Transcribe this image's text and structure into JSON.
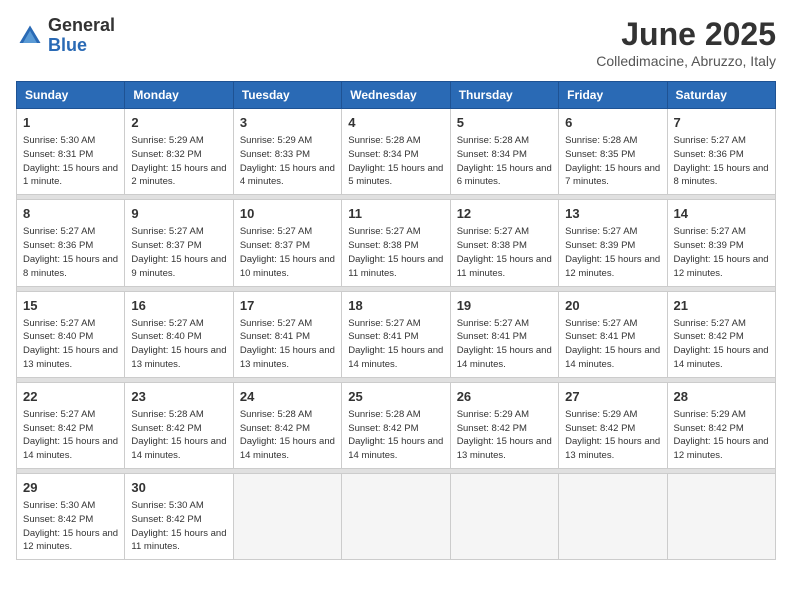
{
  "logo": {
    "general": "General",
    "blue": "Blue"
  },
  "header": {
    "month": "June 2025",
    "location": "Colledimacine, Abruzzo, Italy"
  },
  "columns": [
    "Sunday",
    "Monday",
    "Tuesday",
    "Wednesday",
    "Thursday",
    "Friday",
    "Saturday"
  ],
  "weeks": [
    [
      {
        "day": "1",
        "info": "Sunrise: 5:30 AM\nSunset: 8:31 PM\nDaylight: 15 hours\nand 1 minute."
      },
      {
        "day": "2",
        "info": "Sunrise: 5:29 AM\nSunset: 8:32 PM\nDaylight: 15 hours\nand 2 minutes."
      },
      {
        "day": "3",
        "info": "Sunrise: 5:29 AM\nSunset: 8:33 PM\nDaylight: 15 hours\nand 4 minutes."
      },
      {
        "day": "4",
        "info": "Sunrise: 5:28 AM\nSunset: 8:34 PM\nDaylight: 15 hours\nand 5 minutes."
      },
      {
        "day": "5",
        "info": "Sunrise: 5:28 AM\nSunset: 8:34 PM\nDaylight: 15 hours\nand 6 minutes."
      },
      {
        "day": "6",
        "info": "Sunrise: 5:28 AM\nSunset: 8:35 PM\nDaylight: 15 hours\nand 7 minutes."
      },
      {
        "day": "7",
        "info": "Sunrise: 5:27 AM\nSunset: 8:36 PM\nDaylight: 15 hours\nand 8 minutes."
      }
    ],
    [
      {
        "day": "8",
        "info": "Sunrise: 5:27 AM\nSunset: 8:36 PM\nDaylight: 15 hours\nand 8 minutes."
      },
      {
        "day": "9",
        "info": "Sunrise: 5:27 AM\nSunset: 8:37 PM\nDaylight: 15 hours\nand 9 minutes."
      },
      {
        "day": "10",
        "info": "Sunrise: 5:27 AM\nSunset: 8:37 PM\nDaylight: 15 hours\nand 10 minutes."
      },
      {
        "day": "11",
        "info": "Sunrise: 5:27 AM\nSunset: 8:38 PM\nDaylight: 15 hours\nand 11 minutes."
      },
      {
        "day": "12",
        "info": "Sunrise: 5:27 AM\nSunset: 8:38 PM\nDaylight: 15 hours\nand 11 minutes."
      },
      {
        "day": "13",
        "info": "Sunrise: 5:27 AM\nSunset: 8:39 PM\nDaylight: 15 hours\nand 12 minutes."
      },
      {
        "day": "14",
        "info": "Sunrise: 5:27 AM\nSunset: 8:39 PM\nDaylight: 15 hours\nand 12 minutes."
      }
    ],
    [
      {
        "day": "15",
        "info": "Sunrise: 5:27 AM\nSunset: 8:40 PM\nDaylight: 15 hours\nand 13 minutes."
      },
      {
        "day": "16",
        "info": "Sunrise: 5:27 AM\nSunset: 8:40 PM\nDaylight: 15 hours\nand 13 minutes."
      },
      {
        "day": "17",
        "info": "Sunrise: 5:27 AM\nSunset: 8:41 PM\nDaylight: 15 hours\nand 13 minutes."
      },
      {
        "day": "18",
        "info": "Sunrise: 5:27 AM\nSunset: 8:41 PM\nDaylight: 15 hours\nand 14 minutes."
      },
      {
        "day": "19",
        "info": "Sunrise: 5:27 AM\nSunset: 8:41 PM\nDaylight: 15 hours\nand 14 minutes."
      },
      {
        "day": "20",
        "info": "Sunrise: 5:27 AM\nSunset: 8:41 PM\nDaylight: 15 hours\nand 14 minutes."
      },
      {
        "day": "21",
        "info": "Sunrise: 5:27 AM\nSunset: 8:42 PM\nDaylight: 15 hours\nand 14 minutes."
      }
    ],
    [
      {
        "day": "22",
        "info": "Sunrise: 5:27 AM\nSunset: 8:42 PM\nDaylight: 15 hours\nand 14 minutes."
      },
      {
        "day": "23",
        "info": "Sunrise: 5:28 AM\nSunset: 8:42 PM\nDaylight: 15 hours\nand 14 minutes."
      },
      {
        "day": "24",
        "info": "Sunrise: 5:28 AM\nSunset: 8:42 PM\nDaylight: 15 hours\nand 14 minutes."
      },
      {
        "day": "25",
        "info": "Sunrise: 5:28 AM\nSunset: 8:42 PM\nDaylight: 15 hours\nand 14 minutes."
      },
      {
        "day": "26",
        "info": "Sunrise: 5:29 AM\nSunset: 8:42 PM\nDaylight: 15 hours\nand 13 minutes."
      },
      {
        "day": "27",
        "info": "Sunrise: 5:29 AM\nSunset: 8:42 PM\nDaylight: 15 hours\nand 13 minutes."
      },
      {
        "day": "28",
        "info": "Sunrise: 5:29 AM\nSunset: 8:42 PM\nDaylight: 15 hours\nand 12 minutes."
      }
    ],
    [
      {
        "day": "29",
        "info": "Sunrise: 5:30 AM\nSunset: 8:42 PM\nDaylight: 15 hours\nand 12 minutes."
      },
      {
        "day": "30",
        "info": "Sunrise: 5:30 AM\nSunset: 8:42 PM\nDaylight: 15 hours\nand 11 minutes."
      },
      null,
      null,
      null,
      null,
      null
    ]
  ]
}
